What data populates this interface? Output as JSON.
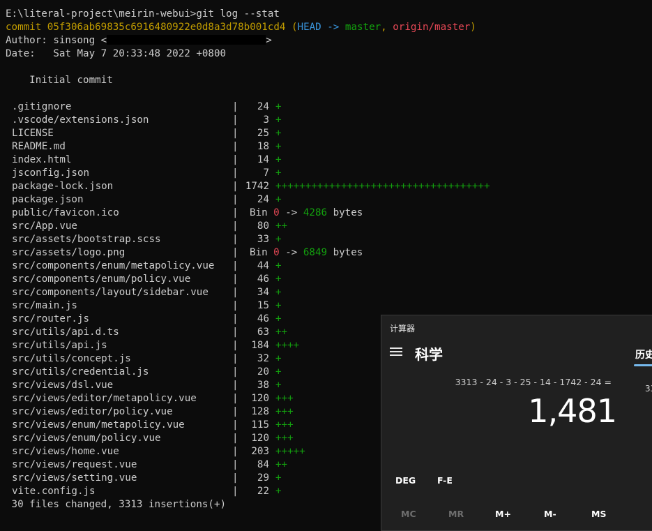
{
  "terminal": {
    "prompt_line": "E:\\literal-project\\meirin-webui>git log --stat",
    "commit_label": "commit",
    "commit_hash": "05f306ab69835c6916480922e0d8a3d78b001cd4",
    "ref_open": " (",
    "ref_head": "HEAD ->",
    "ref_master": " master",
    "ref_sep": ",",
    "ref_origin": " origin/master",
    "ref_close": ")",
    "author_label": "Author: sinsong <",
    "author_close": ">",
    "date_line": "Date:   Sat May 7 20:33:48 2022 +0800",
    "message": "    Initial commit",
    "bar": "|",
    "files": [
      {
        "name": ".gitignore",
        "num": "24",
        "plus": "+"
      },
      {
        "name": ".vscode/extensions.json",
        "num": "3",
        "plus": "+"
      },
      {
        "name": "LICENSE",
        "num": "25",
        "plus": "+"
      },
      {
        "name": "README.md",
        "num": "18",
        "plus": "+"
      },
      {
        "name": "index.html",
        "num": "14",
        "plus": "+"
      },
      {
        "name": "jsconfig.json",
        "num": "7",
        "plus": "+"
      },
      {
        "name": "package-lock.json",
        "num": "1742",
        "plus": "++++++++++++++++++++++++++++++++++++"
      },
      {
        "name": "package.json",
        "num": "24",
        "plus": "+"
      },
      {
        "name": "public/favicon.ico",
        "bin": true,
        "bin_label": "Bin",
        "from": "0",
        "arrow": " -> ",
        "to": "4286",
        "unit": " bytes"
      },
      {
        "name": "src/App.vue",
        "num": "80",
        "plus": "++"
      },
      {
        "name": "src/assets/bootstrap.scss",
        "num": "33",
        "plus": "+"
      },
      {
        "name": "src/assets/logo.png",
        "bin": true,
        "bin_label": "Bin",
        "from": "0",
        "arrow": " -> ",
        "to": "6849",
        "unit": " bytes"
      },
      {
        "name": "src/components/enum/metapolicy.vue",
        "num": "44",
        "plus": "+"
      },
      {
        "name": "src/components/enum/policy.vue",
        "num": "46",
        "plus": "+"
      },
      {
        "name": "src/components/layout/sidebar.vue",
        "num": "34",
        "plus": "+"
      },
      {
        "name": "src/main.js",
        "num": "15",
        "plus": "+"
      },
      {
        "name": "src/router.js",
        "num": "46",
        "plus": "+"
      },
      {
        "name": "src/utils/api.d.ts",
        "num": "63",
        "plus": "++"
      },
      {
        "name": "src/utils/api.js",
        "num": "184",
        "plus": "++++"
      },
      {
        "name": "src/utils/concept.js",
        "num": "32",
        "plus": "+"
      },
      {
        "name": "src/utils/credential.js",
        "num": "20",
        "plus": "+"
      },
      {
        "name": "src/views/dsl.vue",
        "num": "38",
        "plus": "+"
      },
      {
        "name": "src/views/editor/metapolicy.vue",
        "num": "120",
        "plus": "+++"
      },
      {
        "name": "src/views/editor/policy.vue",
        "num": "128",
        "plus": "+++"
      },
      {
        "name": "src/views/enum/metapolicy.vue",
        "num": "115",
        "plus": "+++"
      },
      {
        "name": "src/views/enum/policy.vue",
        "num": "120",
        "plus": "+++"
      },
      {
        "name": "src/views/home.vue",
        "num": "203",
        "plus": "+++++"
      },
      {
        "name": "src/views/request.vue",
        "num": "84",
        "plus": "++"
      },
      {
        "name": "src/views/setting.vue",
        "num": "29",
        "plus": "+"
      },
      {
        "name": "vite.config.js",
        "num": "22",
        "plus": "+"
      }
    ],
    "summary": " 30 files changed, 3313 insertions(+)"
  },
  "calculator": {
    "title": "计算器",
    "mode": "科学",
    "history_tab": "历史",
    "history_partial": "33",
    "expression": "3313 - 24 - 3 - 25 - 14 - 1742 - 24 =",
    "result": "1,481",
    "deg": "DEG",
    "fe": "F-E",
    "memory": [
      "MC",
      "MR",
      "M+",
      "M-",
      "MS"
    ]
  },
  "colors": {
    "background": "#0c0c0c",
    "commit_yellow": "#c19c00",
    "head_cyan": "#3a96dd",
    "plus_green": "#13a10e",
    "origin_red": "#e74856",
    "calc_bg": "#202020",
    "accent": "#76b9ed"
  }
}
